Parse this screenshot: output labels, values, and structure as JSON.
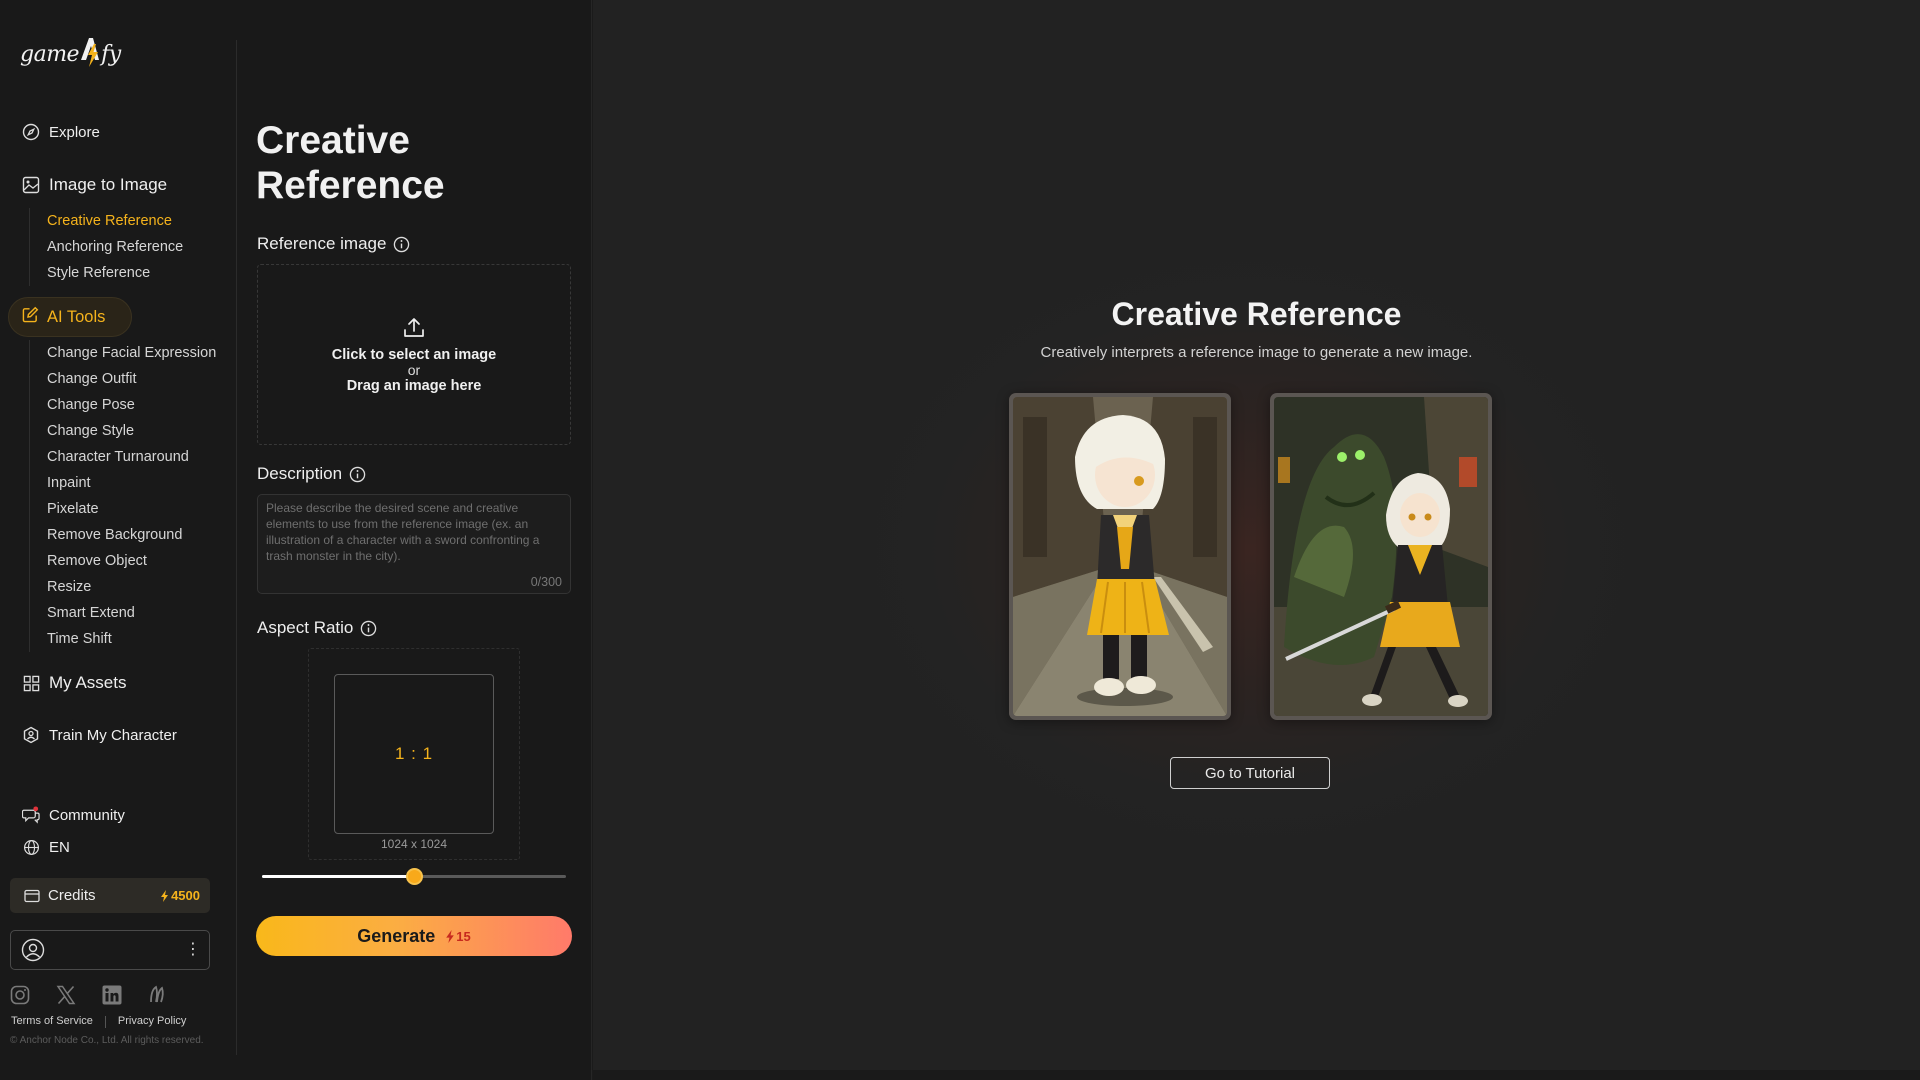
{
  "brand": {
    "logo_text_left": "game",
    "logo_text_right": "fy",
    "accent": "#f5b31c"
  },
  "sidebar": {
    "explore": "Explore",
    "image_to_image": "Image to Image",
    "image_to_image_items": [
      "Creative Reference",
      "Anchoring Reference",
      "Style Reference"
    ],
    "ai_tools": "AI Tools",
    "ai_tools_items": [
      "Change Facial Expression",
      "Change Outfit",
      "Change Pose",
      "Change Style",
      "Character Turnaround",
      "Inpaint",
      "Pixelate",
      "Remove Background",
      "Remove Object",
      "Resize",
      "Smart Extend",
      "Time Shift"
    ],
    "my_assets": "My Assets",
    "train_my_character": "Train My Character",
    "community": "Community",
    "language": "EN",
    "credits_label": "Credits",
    "credits_value": "4500",
    "terms": "Terms of Service",
    "privacy": "Privacy Policy",
    "copyright": "© Anchor Node Co., Ltd. All rights reserved."
  },
  "form": {
    "title": "Creative Reference",
    "reference_label": "Reference image",
    "dropzone_line1": "Click to select an image",
    "dropzone_or": "or",
    "dropzone_line2": "Drag an image here",
    "description_label": "Description",
    "description_placeholder": "Please describe the desired scene and creative elements to use from the reference image (ex. an illustration of a character with a sword confronting a trash monster in the city).",
    "description_count": "0/300",
    "aspect_label": "Aspect Ratio",
    "aspect_value": "1 : 1",
    "aspect_size": "1024 x 1024",
    "aspect_slider_fraction": 0.5,
    "generate_label": "Generate",
    "generate_cost": "15"
  },
  "main": {
    "title": "Creative Reference",
    "subtitle": "Creatively interprets a reference image to generate a new image.",
    "tutorial_button": "Go to Tutorial"
  }
}
